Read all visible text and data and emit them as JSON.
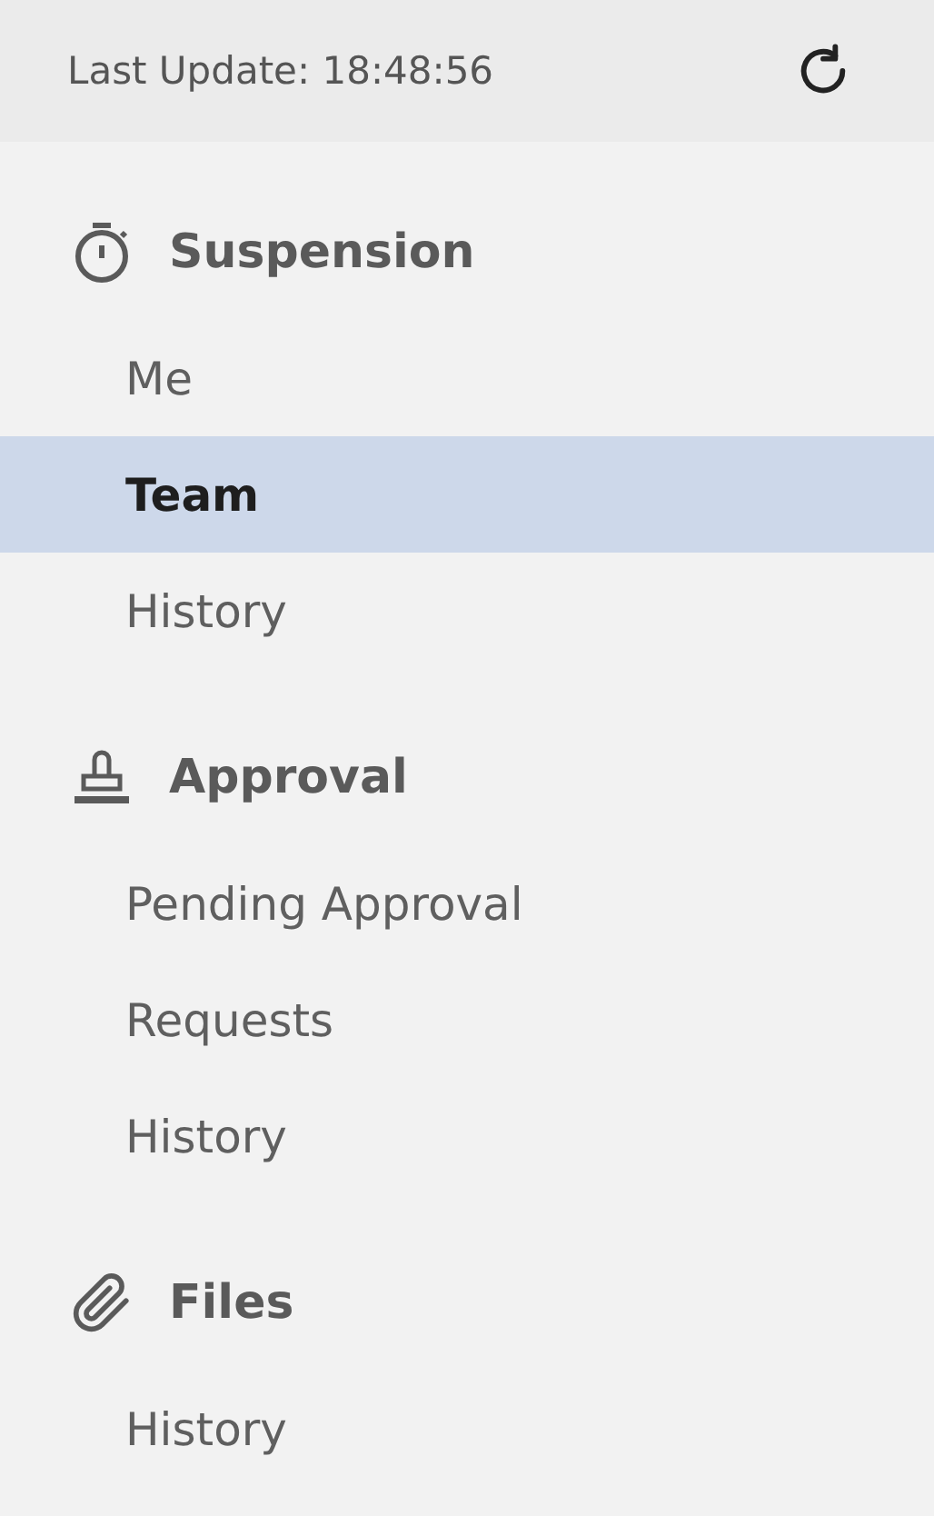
{
  "header": {
    "last_update": "Last Update: 18:48:56"
  },
  "sections": [
    {
      "kind": "timer",
      "title": "Suspension",
      "items": [
        {
          "label": "Me",
          "selected": false
        },
        {
          "label": "Team",
          "selected": true
        },
        {
          "label": "History",
          "selected": false
        }
      ]
    },
    {
      "kind": "stamp",
      "title": "Approval",
      "items": [
        {
          "label": "Pending Approval",
          "selected": false
        },
        {
          "label": "Requests",
          "selected": false
        },
        {
          "label": "History",
          "selected": false
        }
      ]
    },
    {
      "kind": "clip",
      "title": "Files",
      "items": [
        {
          "label": "History",
          "selected": false
        }
      ]
    }
  ]
}
